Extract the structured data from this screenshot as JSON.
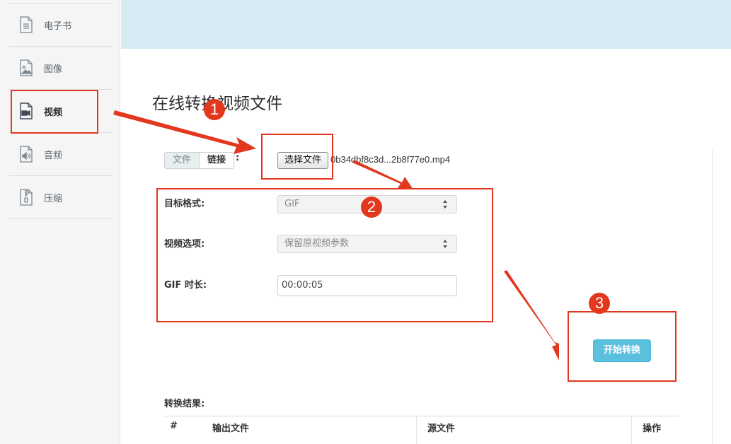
{
  "sidebar": {
    "items": [
      {
        "label": "电子书",
        "icon": "ebook-file-icon"
      },
      {
        "label": "图像",
        "icon": "image-file-icon"
      },
      {
        "label": "视频",
        "icon": "video-file-icon"
      },
      {
        "label": "音频",
        "icon": "audio-file-icon"
      },
      {
        "label": "压缩",
        "icon": "archive-file-icon"
      }
    ]
  },
  "page": {
    "title": "在线转换视频文件"
  },
  "source": {
    "tab_file": "文件",
    "tab_link": "链接",
    "colon": ":",
    "choose_button": "选择文件",
    "file_name": "0b34dbf8c3d...2b8f77e0.mp4"
  },
  "form": {
    "target_format_label": "目标格式:",
    "target_format_value": "GIF",
    "video_options_label": "视频选项:",
    "video_options_value": "保留原视频参数",
    "gif_duration_label": "GIF 时长:",
    "gif_duration_value": "00:00:05"
  },
  "actions": {
    "start_label": "开始转换"
  },
  "results": {
    "title": "转换结果:",
    "columns": [
      "#",
      "输出文件",
      "源文件",
      "操作"
    ]
  },
  "annotations": {
    "badges": [
      "1",
      "2",
      "3"
    ],
    "color": "#e3371e"
  },
  "colors": {
    "banner": "#d7ebf4",
    "start_button": "#5bc0de",
    "sidebar_bg": "#f5f5f5"
  }
}
